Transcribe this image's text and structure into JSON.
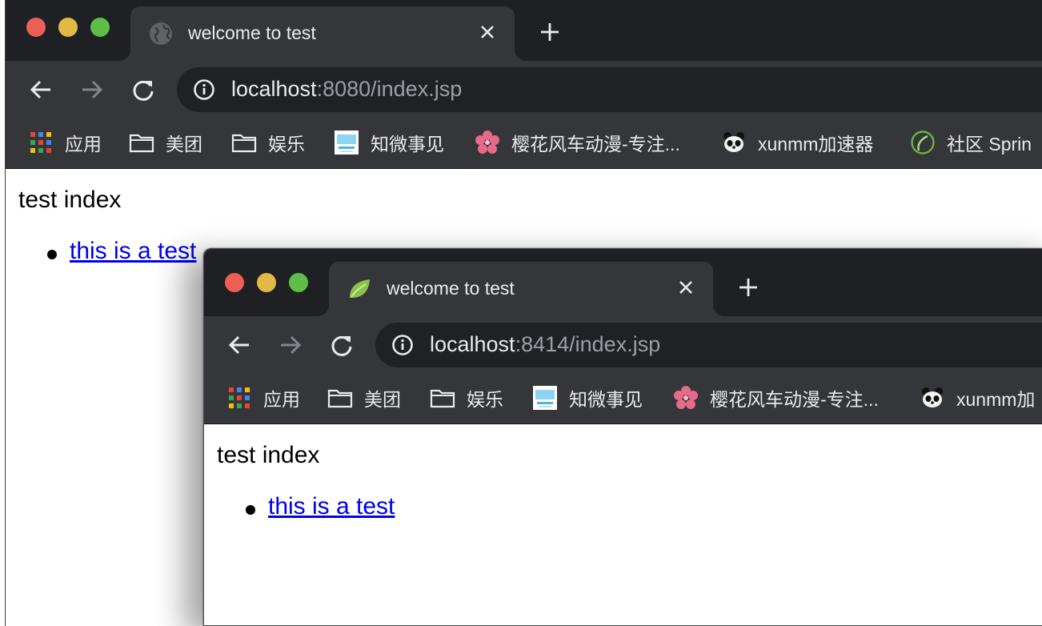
{
  "back_window": {
    "tab": {
      "title": "welcome to test",
      "favicon": "globe-icon"
    },
    "address": {
      "host": "localhost",
      "rest": ":8080/index.jsp"
    },
    "bookmarks": [
      {
        "label": "应用",
        "icon": "apps-grid-icon"
      },
      {
        "label": "美团",
        "icon": "folder-icon"
      },
      {
        "label": "娱乐",
        "icon": "folder-icon"
      },
      {
        "label": "知微事见",
        "icon": "site-thumbnail-icon"
      },
      {
        "label": "樱花风车动漫-专注...",
        "icon": "sakura-icon"
      },
      {
        "label": "xunmm加速器",
        "icon": "panda-icon"
      },
      {
        "label": "社区 Sprin",
        "icon": "spring-leaf-icon"
      }
    ],
    "page": {
      "heading": "test index",
      "link": "this is a test"
    }
  },
  "front_window": {
    "tab": {
      "title": "welcome to test",
      "favicon": "spring-leaf-icon"
    },
    "address": {
      "host": "localhost",
      "rest": ":8414/index.jsp"
    },
    "bookmarks": [
      {
        "label": "应用",
        "icon": "apps-grid-icon"
      },
      {
        "label": "美团",
        "icon": "folder-icon"
      },
      {
        "label": "娱乐",
        "icon": "folder-icon"
      },
      {
        "label": "知微事见",
        "icon": "site-thumbnail-icon"
      },
      {
        "label": "樱花风车动漫-专注...",
        "icon": "sakura-icon"
      },
      {
        "label": "xunmm加",
        "icon": "panda-icon"
      }
    ],
    "page": {
      "heading": "test index",
      "link": "this is a test"
    }
  },
  "colors": {
    "titlebar": "#1f2023",
    "toolbar": "#35363a",
    "omnibox": "#202124",
    "link": "#0000ee",
    "close_light": "#ec5f57",
    "minimize_light": "#e1b945",
    "zoom_light": "#5fbe48"
  }
}
